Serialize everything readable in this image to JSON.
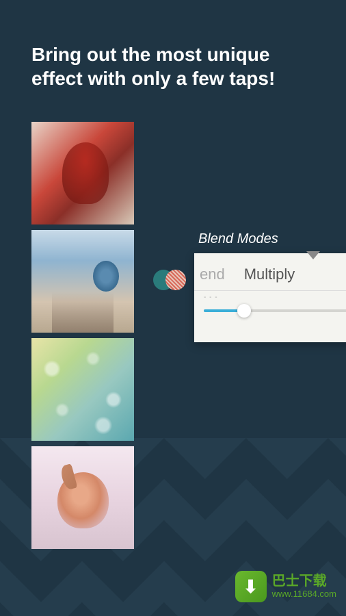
{
  "headline": "Bring out the most unique effect with only a few taps!",
  "thumbnails": [
    {
      "name": "sample-double-exposure-portrait"
    },
    {
      "name": "sample-face-closeup"
    },
    {
      "name": "sample-birds-abstract"
    },
    {
      "name": "sample-cat-blend"
    }
  ],
  "callout": {
    "title": "Blend Modes",
    "icon": "venn-overlap-icon",
    "modes": {
      "partial_prev": "end",
      "active": "Multiply"
    },
    "separator": "- - -",
    "slider_value": 28
  },
  "watermark": {
    "logo_glyph": "⬇",
    "brand": "巴士下载",
    "url": "www.11684.com"
  }
}
